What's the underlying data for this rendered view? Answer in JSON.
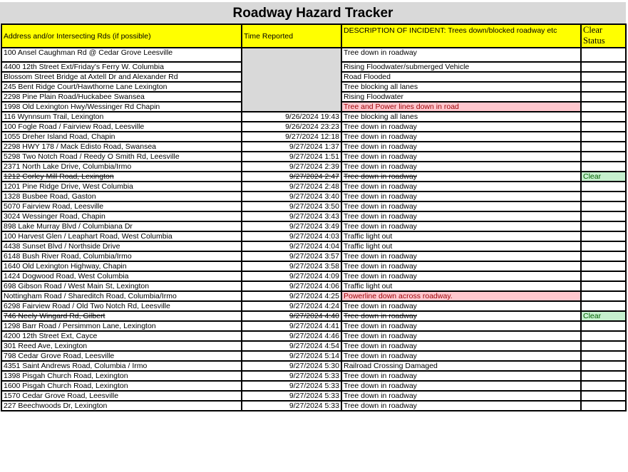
{
  "title": "Roadway Hazard Tracker",
  "columns": {
    "address": "Address and/or Intersecting Rds (if possible)",
    "time": "Time Reported",
    "description": "DESCRIPTION OF INCIDENT:  Trees down/blocked roadway etc",
    "status": "Clear Status"
  },
  "colors": {
    "title_bg": "#d9d9d9",
    "header_bg": "#ffff00",
    "merged_time_bg": "#d9d9d9",
    "alert_bg": "#ffc7ce",
    "alert_text": "#9c0006",
    "clear_bg": "#c6efce",
    "clear_text": "#006100"
  },
  "rows": [
    {
      "address": "100 Ansel Caughman Rd @ Cedar Grove Leesville",
      "time": "",
      "description": "Tree down in roadway",
      "status": "",
      "highlight": "",
      "struck": false
    },
    {
      "address": "4400 12th Street Ext/Friday's Ferry W. Columbia",
      "time": "",
      "description": "Rising Floodwater/submerged Vehicle",
      "status": "",
      "highlight": "",
      "struck": false
    },
    {
      "address": "Blossom Street Bridge at Axtell Dr and Alexander Rd",
      "time": "",
      "description": "Road Flooded",
      "status": "",
      "highlight": "",
      "struck": false
    },
    {
      "address": "245 Bent Ridge Court/Hawthorne Lane Lexington",
      "time": "",
      "description": "Tree blocking all lanes",
      "status": "",
      "highlight": "",
      "struck": false
    },
    {
      "address": "2298 Pine Plain Road/Huckabee Swansea",
      "time": "",
      "description": "Rising Floodwater",
      "status": "",
      "highlight": "",
      "struck": false
    },
    {
      "address": "1998 Old Lexington Hwy/Wessinger Rd Chapin",
      "time": "",
      "description": "Tree and Power lines down in road",
      "status": "",
      "highlight": "alert",
      "struck": false
    },
    {
      "address": "116 Wynnsum Trail, Lexington",
      "time": "9/26/2024 19:43",
      "description": "Tree blocking all lanes",
      "status": "",
      "highlight": "",
      "struck": false
    },
    {
      "address": "100 Fogle Road / Fairview Road, Leesville",
      "time": "9/26/2024 23:23",
      "description": "Tree down in roadway",
      "status": "",
      "highlight": "",
      "struck": false
    },
    {
      "address": "1055 Dreher Island Road, Chapin",
      "time": "9/27/2024 12:18",
      "description": "Tree down in roadway",
      "status": "",
      "highlight": "",
      "struck": false
    },
    {
      "address": "2298 HWY 178 / Mack Edisto Road, Swansea",
      "time": "9/27/2024 1:37",
      "description": "Tree down in roadway",
      "status": "",
      "highlight": "",
      "struck": false
    },
    {
      "address": "5298 Two Notch Road / Reedy O Smith Rd, Leesville",
      "time": "9/27/2024 1:51",
      "description": "Tree down in roadway",
      "status": "",
      "highlight": "",
      "struck": false
    },
    {
      "address": "2371 North Lake Drive, Columbia/Irmo",
      "time": "9/27/2024 2:39",
      "description": "Tree down in roadway",
      "status": "",
      "highlight": "",
      "struck": false
    },
    {
      "address": "1212 Corley Mill Road, Lexington",
      "time": "9/27/2024 2:47",
      "description": "Tree down in roadway",
      "status": "Clear",
      "highlight": "",
      "struck": true
    },
    {
      "address": "1201 Pine Ridge Drive, West Columbia",
      "time": "9/27/2024 2:48",
      "description": "Tree down in roadway",
      "status": "",
      "highlight": "",
      "struck": false
    },
    {
      "address": "1328 Busbee Road, Gaston",
      "time": "9/27/2024 3:40",
      "description": "Tree down in roadway",
      "status": "",
      "highlight": "",
      "struck": false
    },
    {
      "address": "5070 Fairview Road, Leesville",
      "time": "9/27/2024 3:50",
      "description": "Tree down in roadway",
      "status": "",
      "highlight": "",
      "struck": false
    },
    {
      "address": "3024 Wessinger Road, Chapin",
      "time": "9/27/2024 3:43",
      "description": "Tree down in roadway",
      "status": "",
      "highlight": "",
      "struck": false
    },
    {
      "address": "898 Lake Murray Blvd / Columbiana Dr",
      "time": "9/27/2024 3:49",
      "description": "Tree down in roadway",
      "status": "",
      "highlight": "",
      "struck": false
    },
    {
      "address": "100 Harvest Glen / Leaphart Road, West Columbia",
      "time": "9/27/2024 4:03",
      "description": "Traffic light out",
      "status": "",
      "highlight": "",
      "struck": false
    },
    {
      "address": "4438 Sunset Blvd / Northside Drive",
      "time": "9/27/2024 4:04",
      "description": "Traffic light out",
      "status": "",
      "highlight": "",
      "struck": false
    },
    {
      "address": "6148 Bush River Road, Columbia/Irmo",
      "time": "9/27/2024 3:57",
      "description": "Tree down in roadway",
      "status": "",
      "highlight": "",
      "struck": false
    },
    {
      "address": "1640 Old Lexington Highway, Chapin",
      "time": "9/27/2024 3:58",
      "description": "Tree down in roadway",
      "status": "",
      "highlight": "",
      "struck": false
    },
    {
      "address": "1424 Dogwood Road, West Columbia",
      "time": "9/27/2024 4:09",
      "description": "Tree down in roadway",
      "status": "",
      "highlight": "",
      "struck": false
    },
    {
      "address": "698 Gibson Road / West Main St, Lexington",
      "time": "9/27/2024 4:06",
      "description": "Traffic light out",
      "status": "",
      "highlight": "",
      "struck": false
    },
    {
      "address": "Nottingham Road / Shareditch Road, Columbia/Irmo",
      "time": "9/27/2024 4:25",
      "description": "Powerline down across roadway.",
      "status": "",
      "highlight": "alert",
      "struck": false
    },
    {
      "address": "6298 Fairview Road / Old Two Notch Rd, Leesville",
      "time": "9/27/2024 4:24",
      "description": "Tree down in roadway",
      "status": "",
      "highlight": "",
      "struck": false
    },
    {
      "address": "746 Neely Wingard Rd, Gilbert",
      "time": "9/27/2024 4:40",
      "description": "Tree down in roadway",
      "status": "Clear",
      "highlight": "",
      "struck": true
    },
    {
      "address": "1298 Barr Road / Persimmon Lane, Lexington",
      "time": "9/27/2024 4:41",
      "description": "Tree down in roadway",
      "status": "",
      "highlight": "",
      "struck": false
    },
    {
      "address": "4200 12th Street Ext, Cayce",
      "time": "9/27/2024 4:46",
      "description": "Tree down in roadway",
      "status": "",
      "highlight": "",
      "struck": false
    },
    {
      "address": "301 Reed Ave, Lexington",
      "time": "9/27/2024 4:54",
      "description": "Tree down in roadway",
      "status": "",
      "highlight": "",
      "struck": false
    },
    {
      "address": "798 Cedar Grove Road, Leesville",
      "time": "9/27/2024 5:14",
      "description": "Tree down in roadway",
      "status": "",
      "highlight": "",
      "struck": false
    },
    {
      "address": "4351 Saint Andrews Road, Columbia / Irmo",
      "time": "9/27/2024 5:30",
      "description": "Railroad Crossing Damaged",
      "status": "",
      "highlight": "",
      "struck": false
    },
    {
      "address": "1398 Pisgah Church Road, Lexington",
      "time": "9/27/2024 5:33",
      "description": "Tree down in roadway",
      "status": "",
      "highlight": "",
      "struck": false
    },
    {
      "address": "1600 Pisgah Church Road, Lexington",
      "time": "9/27/2024 5:33",
      "description": "Tree down in roadway",
      "status": "",
      "highlight": "",
      "struck": false
    },
    {
      "address": "1570 Cedar Grove Road, Leesville",
      "time": "9/27/2024 5:33",
      "description": "Tree down in roadway",
      "status": "",
      "highlight": "",
      "struck": false
    },
    {
      "address": "227 Beechwoods Dr, Lexington",
      "time": "9/27/2024 5:33",
      "description": "Tree down in roadway",
      "status": "",
      "highlight": "",
      "struck": false
    }
  ]
}
